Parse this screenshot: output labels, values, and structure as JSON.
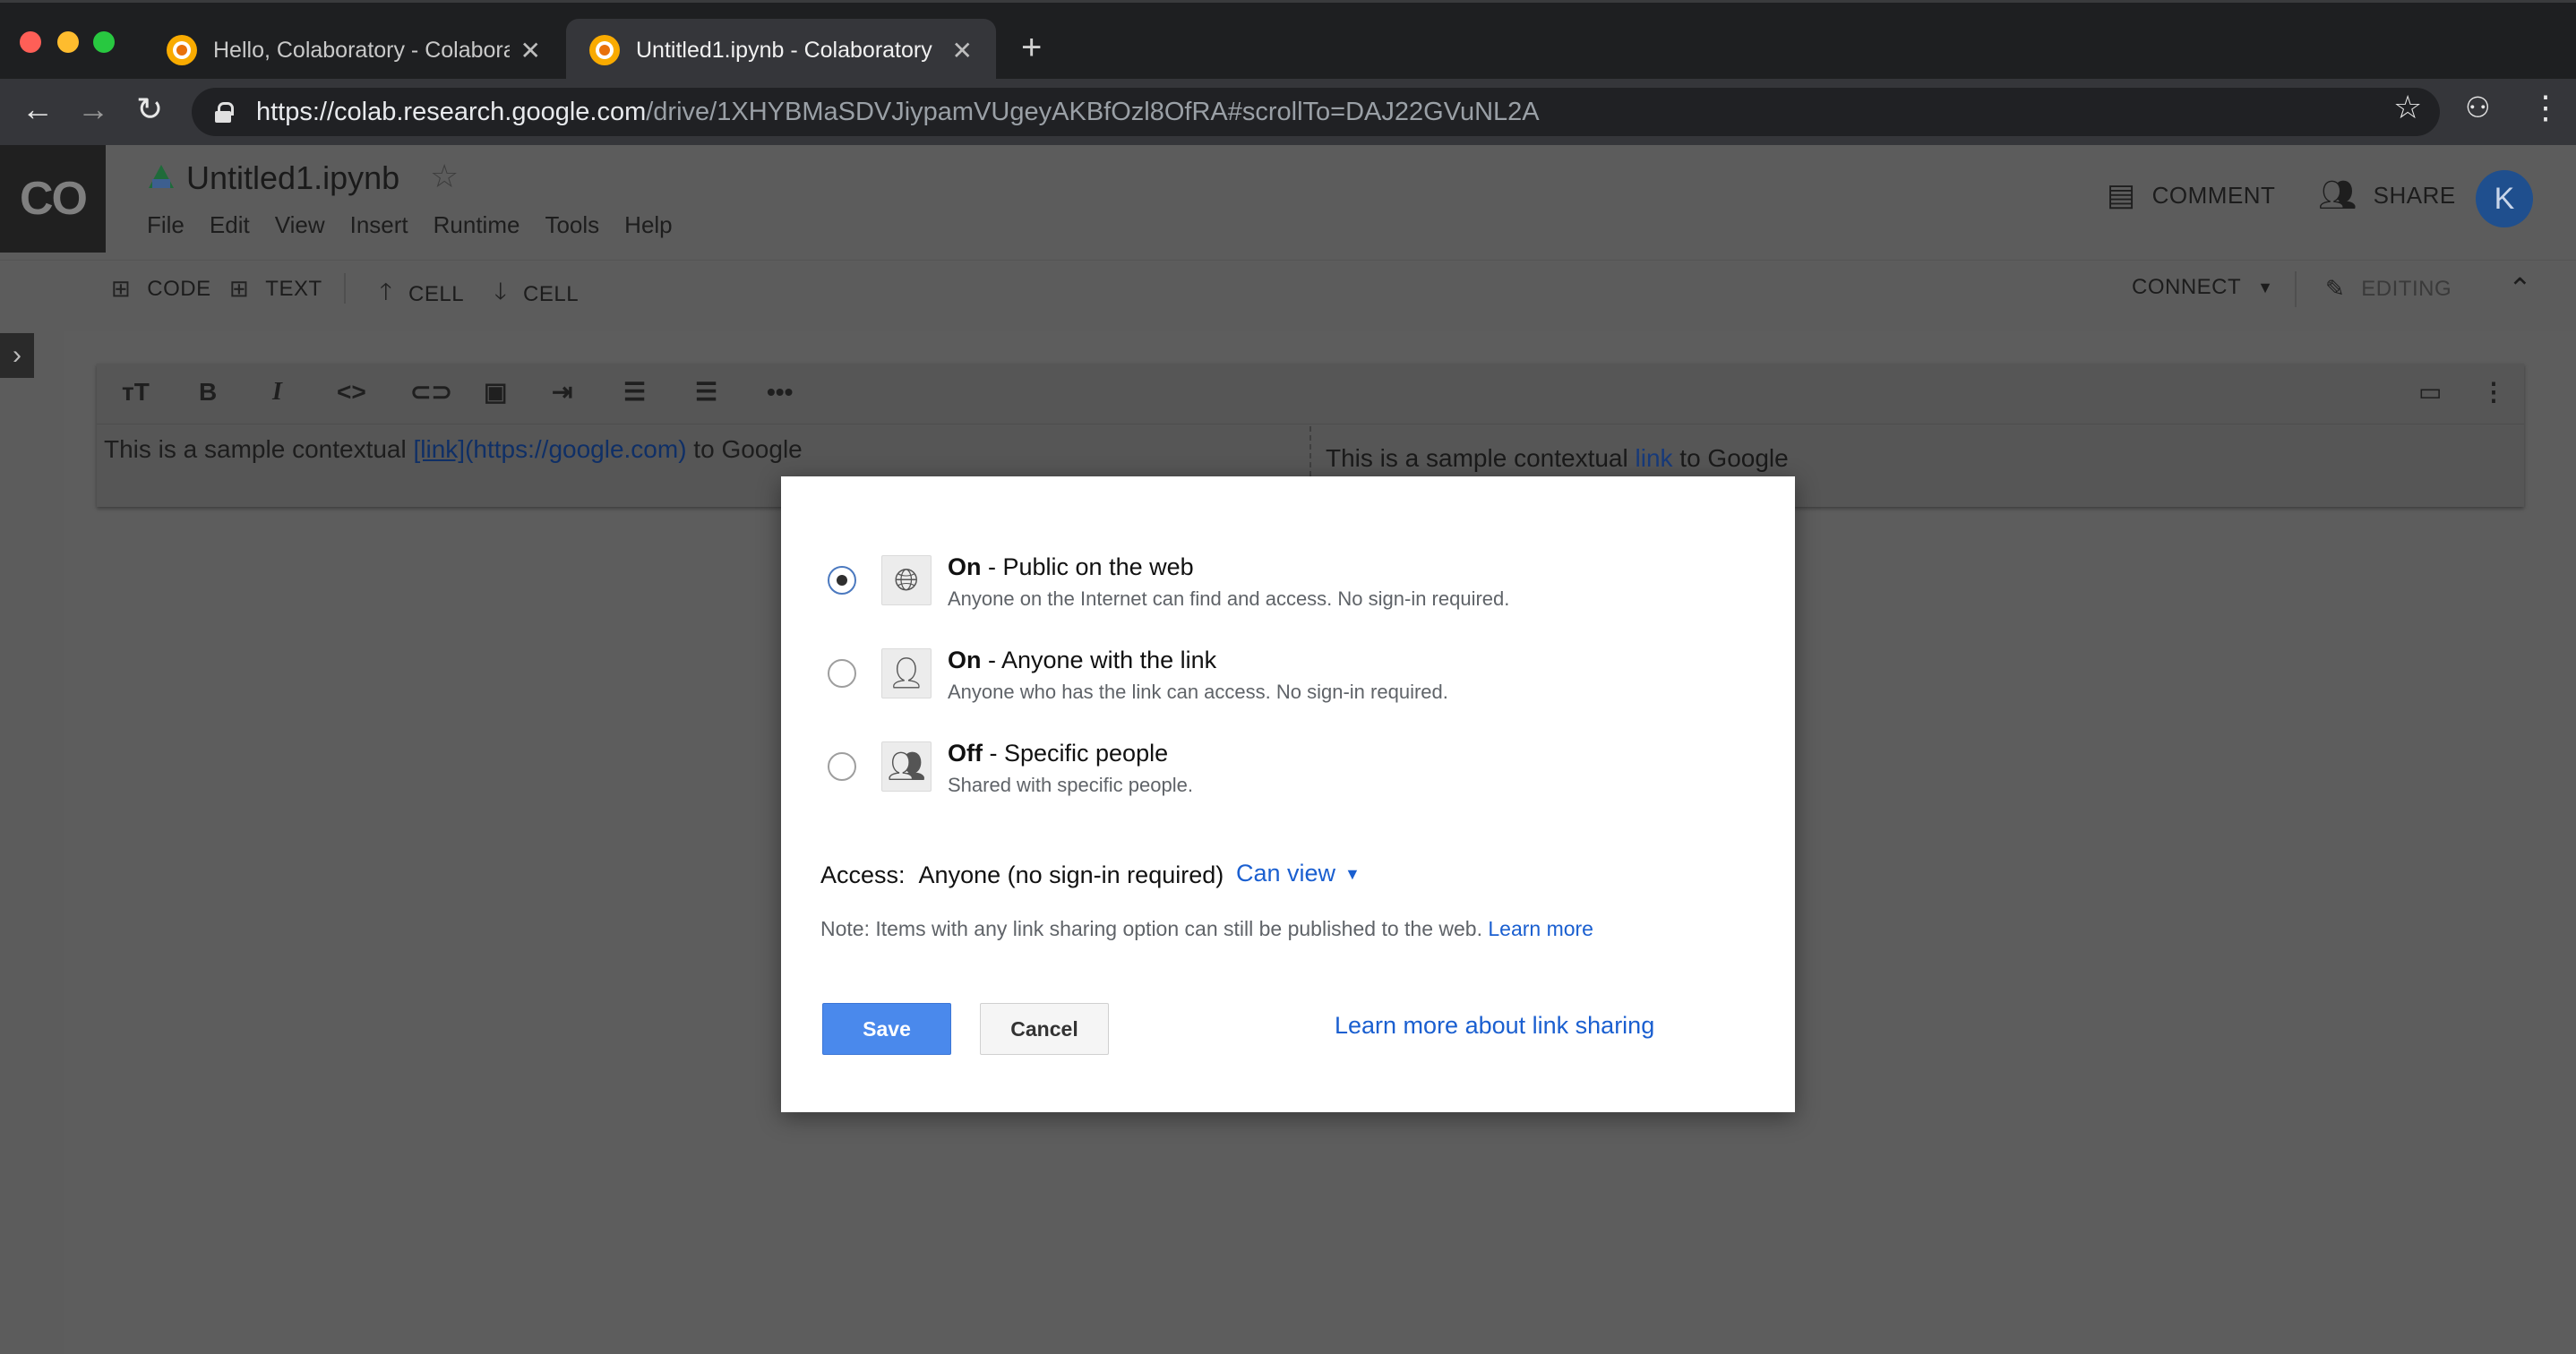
{
  "browser": {
    "tabs": [
      {
        "title": "Hello, Colaboratory - Colabora",
        "active": false
      },
      {
        "title": "Untitled1.ipynb - Colaboratory",
        "active": true
      }
    ],
    "new_tab_icon": "plus-icon",
    "url_host": "https://colab.research.google.com",
    "url_path": "/drive/1XHYBMaSDVJiypamVUgeyAKBfOzl8OfRA#scrollTo=DAJ22GVuNL2A"
  },
  "app": {
    "logo_text": "CO",
    "notebook_title": "Untitled1.ipynb",
    "menu": [
      "File",
      "Edit",
      "View",
      "Insert",
      "Runtime",
      "Tools",
      "Help"
    ],
    "comment_label": "COMMENT",
    "share_label": "SHARE",
    "avatar_letter": "K"
  },
  "toolbar": {
    "code_label": "CODE",
    "text_label": "TEXT",
    "cell_up_label": "CELL",
    "cell_down_label": "CELL",
    "connect_label": "CONNECT",
    "editing_label": "EDITING"
  },
  "cell": {
    "editor_prefix": "This is a sample contextual ",
    "editor_link_text": "[link]",
    "editor_url": "(https://google.com)",
    "editor_suffix": " to Google",
    "preview_prefix": "This is a sample contextual ",
    "preview_link": "link",
    "preview_suffix": " to Google"
  },
  "dialog": {
    "options": [
      {
        "state": "On",
        "title": " - Public on the web",
        "desc": "Anyone on the Internet can find and access. No sign-in required.",
        "icon": "globe-icon",
        "selected": true
      },
      {
        "state": "On",
        "title": " - Anyone with the link",
        "desc": "Anyone who has the link can access. No sign-in required.",
        "icon": "person-link-icon",
        "selected": false
      },
      {
        "state": "Off",
        "title": " - Specific people",
        "desc": "Shared with specific people.",
        "icon": "people-icon",
        "selected": false
      }
    ],
    "access_label": "Access:",
    "access_value": "Anyone (no sign-in required)",
    "permission": "Can view",
    "note": "Note: Items with any link sharing option can still be published to the web. ",
    "note_link": "Learn more",
    "save_label": "Save",
    "cancel_label": "Cancel",
    "learn_more_label": "Learn more about link sharing"
  },
  "colors": {
    "primary_button": "#4a89ec",
    "link": "#1a5fd0",
    "avatar": "#1f4f8e"
  }
}
